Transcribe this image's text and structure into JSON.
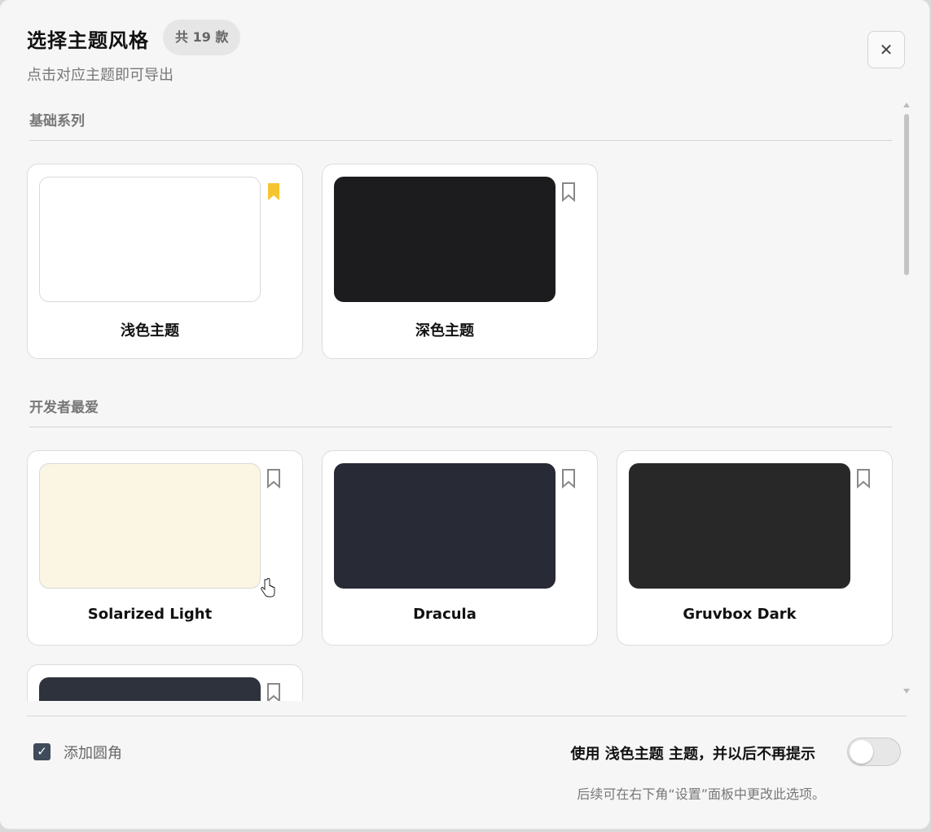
{
  "header": {
    "title": "选择主题风格",
    "count_badge": "共 19 款",
    "subtitle": "点击对应主题即可导出",
    "close_icon": "close-icon"
  },
  "sections": [
    {
      "title": "基础系列",
      "themes": [
        {
          "name": "浅色主题",
          "swatch_color": "#ffffff",
          "bookmarked": true
        },
        {
          "name": "深色主题",
          "swatch_color": "#1c1c1e",
          "bookmarked": false
        }
      ]
    },
    {
      "title": "开发者最爱",
      "themes": [
        {
          "name": "Solarized Light",
          "swatch_color": "#fbf6e4",
          "bookmarked": false
        },
        {
          "name": "Dracula",
          "swatch_color": "#282a36",
          "bookmarked": false
        },
        {
          "name": "Gruvbox Dark",
          "swatch_color": "#282828",
          "bookmarked": false
        },
        {
          "name": "",
          "swatch_color": "#2e323c",
          "bookmarked": false
        }
      ]
    }
  ],
  "footer": {
    "rounded_corners_label": "添加圆角",
    "rounded_corners_checked": true,
    "use_theme_prompt": "使用 浅色主题 主题，并以后不再提示",
    "toggle_on": false,
    "hint": "后续可在右下角“设置”面板中更改此选项。"
  },
  "colors": {
    "bookmark_active": "#f5c531",
    "bookmark_inactive": "#888888",
    "checkbox_fill": "#3f4a5a"
  }
}
